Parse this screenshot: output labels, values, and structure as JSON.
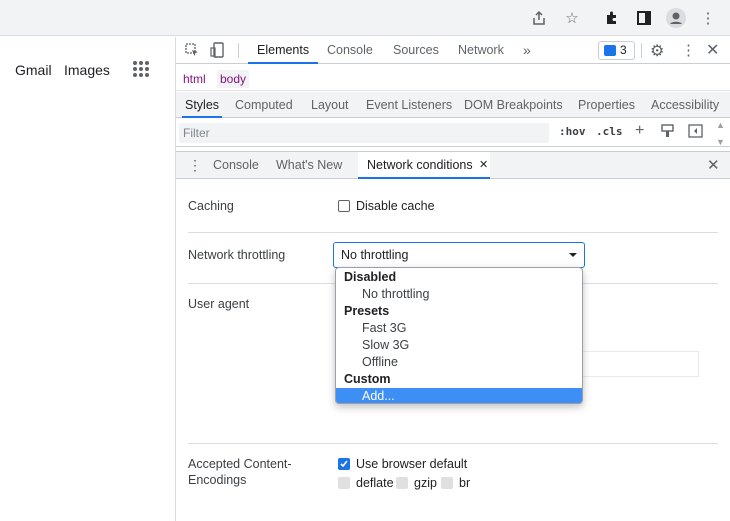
{
  "page": {
    "links": [
      "Gmail",
      "Images"
    ]
  },
  "devtools": {
    "tabs": [
      "Elements",
      "Console",
      "Sources",
      "Network"
    ],
    "issues_count": "3",
    "breadcrumbs": [
      "html",
      "body"
    ],
    "subtabs": [
      "Styles",
      "Computed",
      "Layout",
      "Event Listeners",
      "DOM Breakpoints",
      "Properties",
      "Accessibility"
    ],
    "filter": {
      "placeholder": "Filter",
      "hov": ":hov",
      "cls": ".cls"
    },
    "drawer_tabs": [
      "Console",
      "What's New",
      "Network conditions"
    ]
  },
  "network_conditions": {
    "caching_label": "Caching",
    "disable_cache_label": "Disable cache",
    "throttling_label": "Network throttling",
    "throttling_value": "No throttling",
    "user_agent_label": "User agent",
    "encodings_label_1": "Accepted Content-",
    "encodings_label_2": "Encodings",
    "use_browser_default": "Use browser default",
    "encodings": [
      "deflate",
      "gzip",
      "br"
    ]
  },
  "dropdown": {
    "group_disabled": "Disabled",
    "item_no_throttling": "No throttling",
    "group_presets": "Presets",
    "item_fast3g": "Fast 3G",
    "item_slow3g": "Slow 3G",
    "item_offline": "Offline",
    "group_custom": "Custom",
    "item_add": "Add..."
  },
  "colors": {
    "accent": "#1a73e8",
    "selection": "#3d8ef5"
  }
}
